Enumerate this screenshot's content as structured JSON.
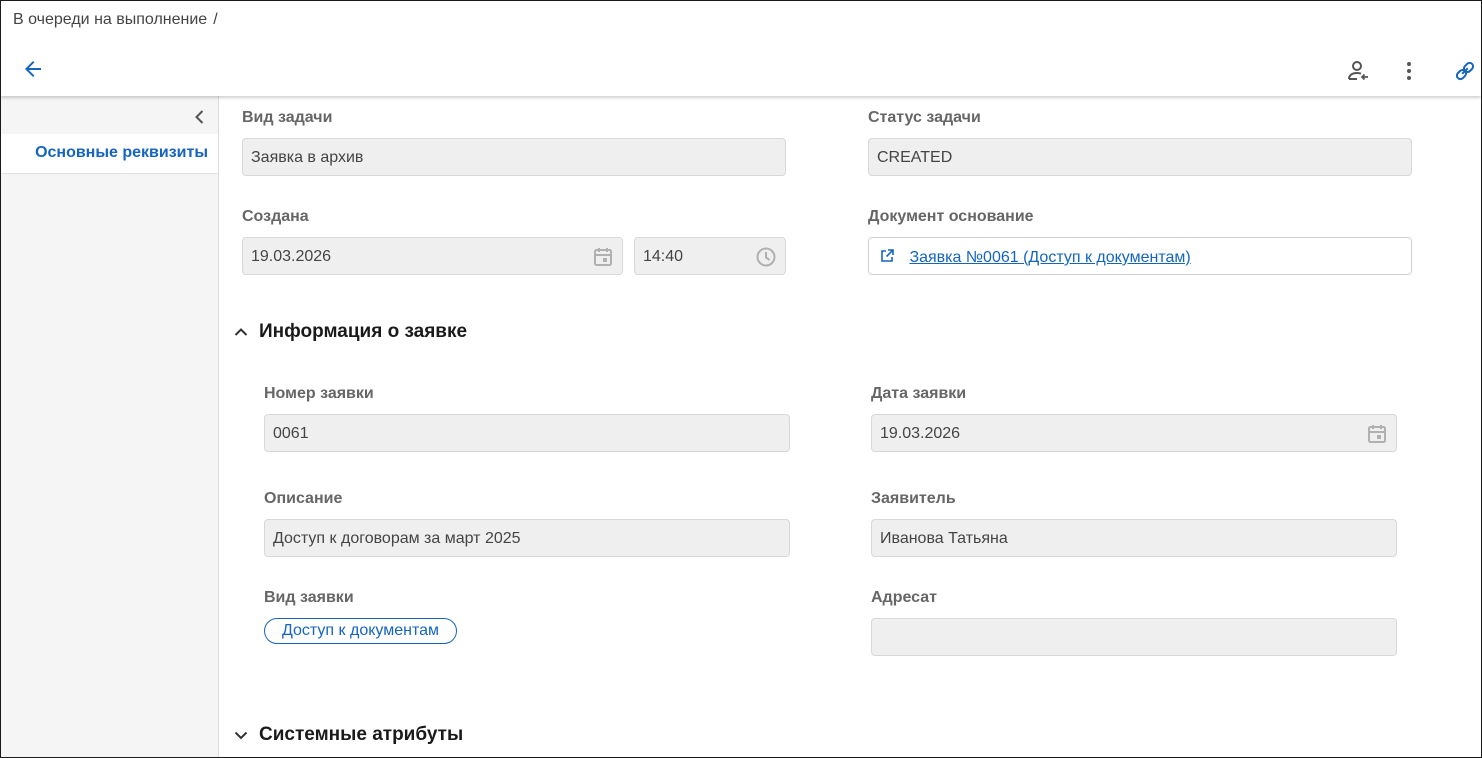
{
  "header": {
    "breadcrumb": "В очереди на выполнение",
    "breadcrumb_sep": "/"
  },
  "sidebar": {
    "items": [
      {
        "label": "Основные реквизиты",
        "active": true
      }
    ]
  },
  "task": {
    "type_label": "Вид задачи",
    "type_value": "Заявка в архив",
    "status_label": "Статус задачи",
    "status_value": "CREATED",
    "created_label": "Создана",
    "created_date": "19.03.2026",
    "created_time": "14:40",
    "basis_label": "Документ основание",
    "basis_link": "Заявка №0061 (Доступ к документам)"
  },
  "request_section": {
    "title": "Информация о заявке",
    "expanded": true,
    "number_label": "Номер заявки",
    "number_value": "0061",
    "date_label": "Дата заявки",
    "date_value": "19.03.2026",
    "description_label": "Описание",
    "description_value": "Доступ к договорам за март 2025",
    "applicant_label": "Заявитель",
    "applicant_value": "Иванова Татьяна",
    "kind_label": "Вид заявки",
    "kind_chip": "Доступ к документам",
    "addressee_label": "Адресат",
    "addressee_value": ""
  },
  "system_section": {
    "title": "Системные атрибуты",
    "expanded": false
  },
  "colors": {
    "accent": "#1565c0",
    "field_bg": "#efefef",
    "sidebar_bg": "#f5f5f5"
  },
  "icons": [
    "back-arrow-icon",
    "assign-user-icon",
    "more-vert-icon",
    "link-icon",
    "chevron-left-icon",
    "calendar-icon",
    "clock-icon",
    "external-link-icon",
    "chevron-up-icon",
    "chevron-down-icon"
  ]
}
